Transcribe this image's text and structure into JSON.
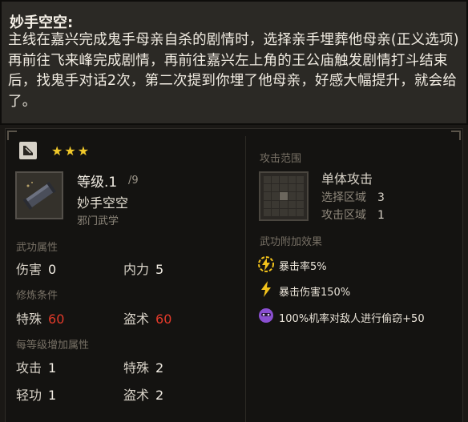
{
  "tip": {
    "title": "妙手空空:",
    "body": "主线在嘉兴完成鬼手母亲自杀的剧情时，选择亲手埋葬他母亲(正义选项)再前往飞来峰完成剧情，再前往嘉兴左上角的王公庙触发剧情打斗结束后，找鬼手对话2次，第二次提到你埋了他母亲，好感大幅提升，就会给了。"
  },
  "skill": {
    "stars": "★★★",
    "level": "等级.1",
    "max_level": "/9",
    "name": "妙手空空",
    "school": "邪门武学"
  },
  "attrs": {
    "section": "武功属性",
    "damage_label": "伤害",
    "damage_value": "0",
    "neili_label": "内力",
    "neili_value": "5"
  },
  "reqs": {
    "section": "修炼条件",
    "special_label": "特殊",
    "special_value": "60",
    "steal_label": "盗术",
    "steal_value": "60"
  },
  "growth": {
    "section": "每等级增加属性",
    "attack_label": "攻击",
    "attack_value": "1",
    "special_label": "特殊",
    "special_value": "2",
    "qinggong_label": "轻功",
    "qinggong_value": "1",
    "steal_label": "盗术",
    "steal_value": "2"
  },
  "range": {
    "section": "攻击范围",
    "type": "单体攻击",
    "select_label": "选择区域",
    "select_value": "3",
    "attack_area_label": "攻击区域",
    "attack_area_value": "1"
  },
  "effects": {
    "section": "武功附加效果",
    "items": [
      {
        "icon": "lightning-circle-icon",
        "text": "暴击率5%"
      },
      {
        "icon": "lightning-icon",
        "text": "暴击伤害150%"
      },
      {
        "icon": "purple-mask-icon",
        "text": "100%机率对敌人进行偷窃+50"
      }
    ]
  },
  "colors": {
    "star": "#f0c82a",
    "requirement_value": "#e23a2a",
    "effect_icon_yellow": "#f2c21b",
    "effect_icon_purple": "#8a4fd1"
  }
}
